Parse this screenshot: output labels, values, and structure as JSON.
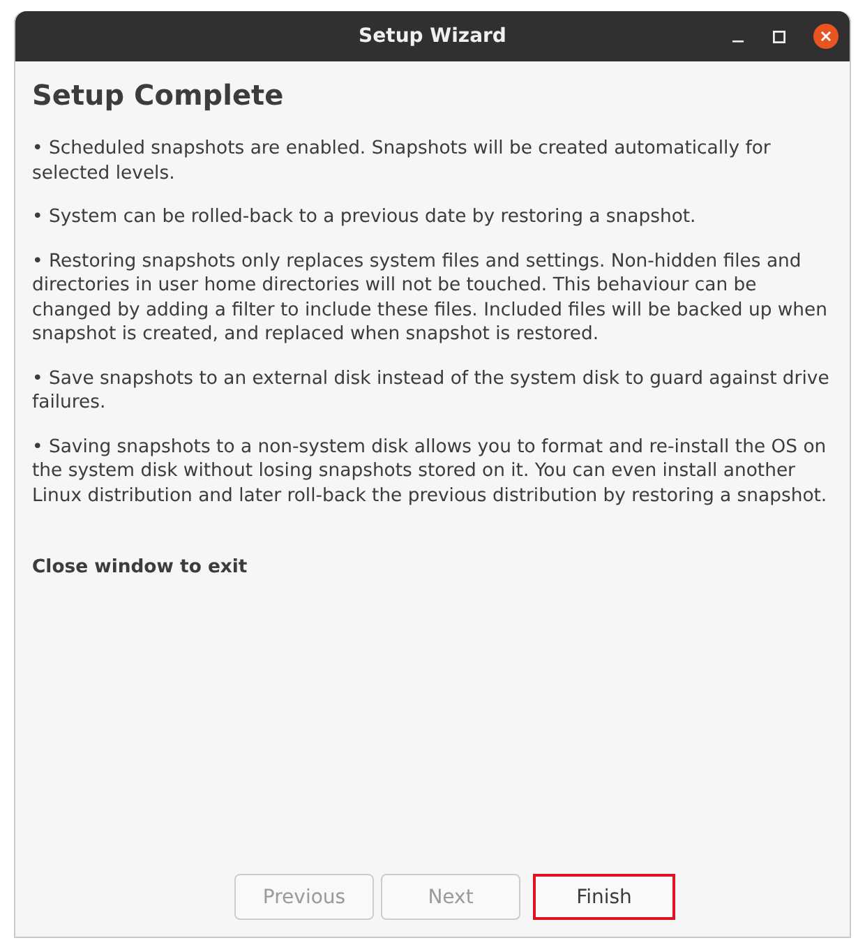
{
  "window": {
    "title": "Setup Wizard"
  },
  "heading": "Setup Complete",
  "paragraphs": [
    "• Scheduled snapshots are enabled. Snapshots will be created automatically for selected levels.",
    "• System can be rolled-back to a previous date by restoring a snapshot.",
    "• Restoring snapshots only replaces system files and settings. Non-hidden files and directories in user home directories will not be touched. This behaviour can be changed by adding a filter to include these files. Included files will be backed up when snapshot is created, and replaced when snapshot is restored.",
    "• Save snapshots to an external disk instead of the system disk to guard against drive failures.",
    "• Saving snapshots to a non-system disk allows you to format and re-install the OS on the system disk without losing snapshots stored on it. You can even install another Linux distribution and later roll-back the previous distribution by restoring a snapshot."
  ],
  "note": "Close window to exit",
  "buttons": [
    {
      "label": "Previous",
      "disabled": true,
      "highlighted": false
    },
    {
      "label": "Next",
      "disabled": true,
      "highlighted": false
    },
    {
      "label": "Finish",
      "disabled": false,
      "highlighted": true
    }
  ]
}
